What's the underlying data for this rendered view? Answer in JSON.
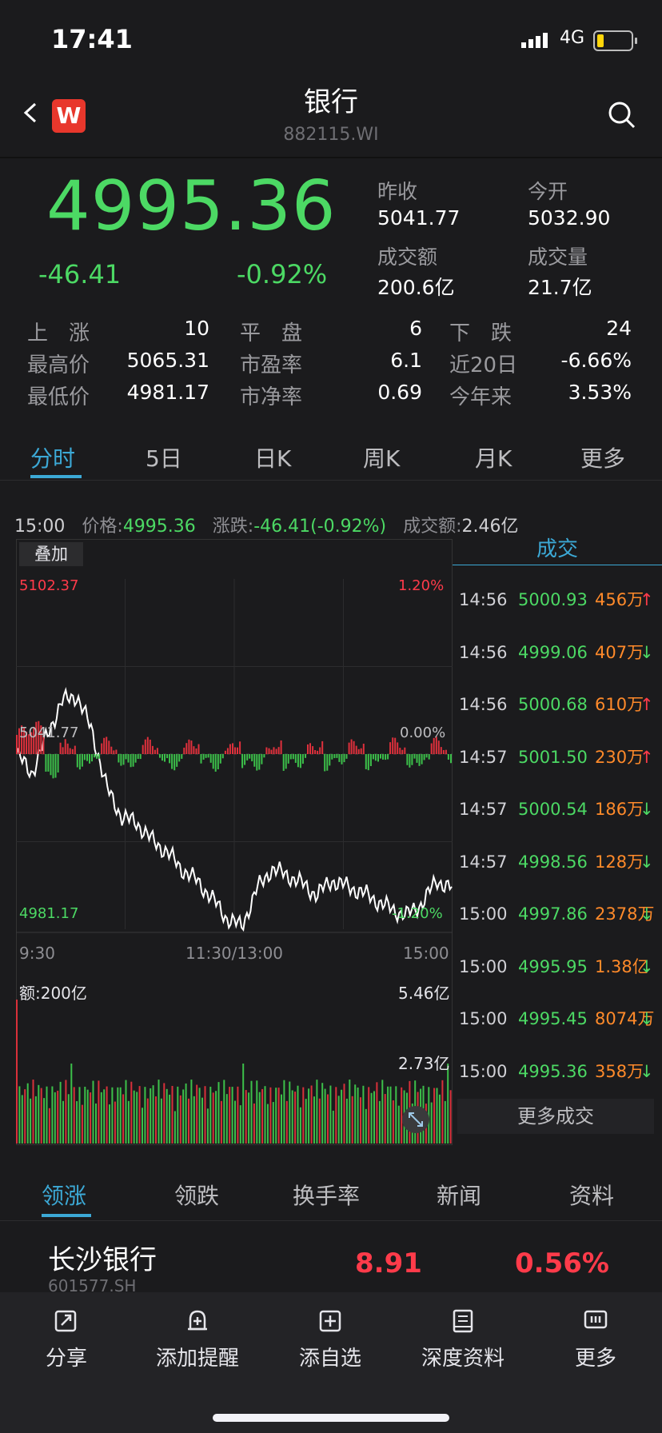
{
  "status": {
    "time": "17:41",
    "network": "4G"
  },
  "nav": {
    "title": "银行",
    "code": "882115.WI",
    "logo_letter": "W"
  },
  "quote": {
    "price": "4995.36",
    "change": "-46.41",
    "change_pct": "-0.92%",
    "prev_close_label": "昨收",
    "prev_close": "5041.77",
    "open_label": "今开",
    "open": "5032.90",
    "turnover_label": "成交额",
    "turnover": "200.6亿",
    "volume_label": "成交量",
    "volume": "21.7亿"
  },
  "stats": {
    "up_label": "上　涨",
    "up": "10",
    "flat_label": "平　盘",
    "flat": "6",
    "down_label": "下　跌",
    "down": "24",
    "high_label": "最高价",
    "high": "5065.31",
    "pe_label": "市盈率",
    "pe": "6.1",
    "d20_label": "近20日",
    "d20": "-6.66%",
    "low_label": "最低价",
    "low": "4981.17",
    "pb_label": "市净率",
    "pb": "0.69",
    "ytd_label": "今年来",
    "ytd": "3.53%"
  },
  "tabs": [
    "分时",
    "5日",
    "日K",
    "周K",
    "月K",
    "更多"
  ],
  "chart_header": {
    "time": "15:00",
    "price_label": "价格:",
    "price": "4995.36",
    "chg_label": "涨跌:",
    "chg": "-46.41(-0.92%)",
    "amt_label": "成交额:",
    "amt": "2.46亿"
  },
  "chart": {
    "overlay_label": "叠加",
    "y_top": "5102.37",
    "y_mid": "5041.77",
    "y_bottom": "4981.17",
    "pct_top": "1.20%",
    "pct_mid": "0.00%",
    "pct_bottom": "-1.20%",
    "x_start": "9:30",
    "x_mid": "11:30/13:00",
    "x_end": "15:00",
    "vol_label": "额:200亿",
    "vol_top": "5.46亿",
    "vol_mid": "2.73亿"
  },
  "chart_data": {
    "type": "line",
    "title": "",
    "x": [
      "9:30",
      "11:30/13:00",
      "15:00"
    ],
    "xlabel": "",
    "ylabel": "",
    "ylim": [
      4981.17,
      5102.37
    ],
    "series": [
      {
        "values": [
          5041.77,
          5035,
          5048,
          5060,
          5062,
          5050,
          5030,
          5020,
          5018,
          5012,
          5008,
          5002,
          4998,
          4992,
          4985,
          4982,
          4995,
          5002,
          5000,
          4997,
          4993,
          4998,
          4996,
          4994,
          4991,
          4988,
          4986,
          4990,
          4998,
          4995.36
        ]
      }
    ],
    "volume_ylim": [
      0,
      5.46
    ]
  },
  "trades": {
    "title": "成交",
    "rows": [
      {
        "time": "14:56",
        "price": "5000.93",
        "vol": "456万",
        "dir": "↑",
        "color": "#ff3b4a"
      },
      {
        "time": "14:56",
        "price": "4999.06",
        "vol": "407万",
        "dir": "↓",
        "color": "#4cd964"
      },
      {
        "time": "14:56",
        "price": "5000.68",
        "vol": "610万",
        "dir": "↑",
        "color": "#ff3b4a"
      },
      {
        "time": "14:57",
        "price": "5001.50",
        "vol": "230万",
        "dir": "↑",
        "color": "#ff3b4a"
      },
      {
        "time": "14:57",
        "price": "5000.54",
        "vol": "186万",
        "dir": "↓",
        "color": "#4cd964"
      },
      {
        "time": "14:57",
        "price": "4998.56",
        "vol": "128万",
        "dir": "↓",
        "color": "#4cd964"
      },
      {
        "time": "15:00",
        "price": "4997.86",
        "vol": "2378万",
        "dir": "↓",
        "color": "#4cd964"
      },
      {
        "time": "15:00",
        "price": "4995.95",
        "vol": "1.38亿",
        "dir": "↓",
        "color": "#4cd964"
      },
      {
        "time": "15:00",
        "price": "4995.45",
        "vol": "8074万",
        "dir": "↓",
        "color": "#4cd964"
      },
      {
        "time": "15:00",
        "price": "4995.36",
        "vol": "358万",
        "dir": "↓",
        "color": "#4cd964"
      }
    ],
    "more": "更多成交"
  },
  "bottom_tabs": [
    "领涨",
    "领跌",
    "换手率",
    "新闻",
    "资料"
  ],
  "stock": {
    "name": "长沙银行",
    "code": "601577.SH",
    "price": "8.91",
    "pct": "0.56%"
  },
  "toolbar": [
    {
      "label": "分享",
      "icon": "share-icon"
    },
    {
      "label": "添加提醒",
      "icon": "bell-plus-icon"
    },
    {
      "label": "添自选",
      "icon": "add-square-icon"
    },
    {
      "label": "深度资料",
      "icon": "book-icon"
    },
    {
      "label": "更多",
      "icon": "more-icon"
    }
  ]
}
